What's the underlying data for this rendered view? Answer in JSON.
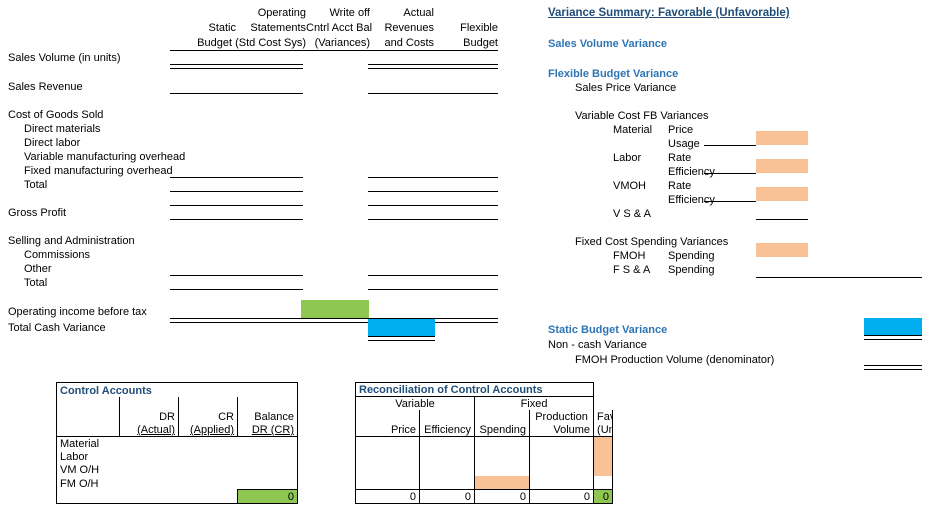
{
  "statement": {
    "column_headers": [
      {
        "lines": [
          "",
          "Static",
          "Budget (Std Cost Sys)"
        ],
        "name": "static-budget"
      },
      {
        "lines": [
          "Operating",
          "Statements",
          ""
        ],
        "name": "operating-statements"
      },
      {
        "lines": [
          "Write off",
          "Cntrl Acct Bal",
          "(Variances)"
        ],
        "name": "write-off-cntrl-acct-bal"
      },
      {
        "lines": [
          "Actual",
          "Revenues",
          "and Costs"
        ],
        "name": "actual-revenues-and-costs"
      },
      {
        "lines": [
          "",
          "Flexible",
          "Budget"
        ],
        "name": "flexible-budget"
      }
    ],
    "rows": [
      "Sales Volume (in units)",
      "Sales Revenue",
      "Cost of Goods Sold",
      "Direct materials",
      "Direct labor",
      "Variable manufacturing overhead",
      "Fixed manufacturing overhead",
      "Total",
      "Gross Profit",
      "Selling and Administration",
      "Commissions",
      "Other",
      "Total",
      "Operating income before tax",
      "Total Cash Variance"
    ]
  },
  "variance_summary": {
    "title": "Variance Summary:  Favorable (Unfavorable)",
    "sales_volume_variance": "Sales Volume Variance",
    "flexible_budget_variance": "Flexible Budget Variance",
    "sales_price_variance": "Sales Price  Variance",
    "variable_cost_heading": "Variable Cost FB Variances",
    "variable_rows": [
      {
        "category": "Material",
        "measure": "Price"
      },
      {
        "category": "",
        "measure": "Usage"
      },
      {
        "category": "Labor",
        "measure": "Rate"
      },
      {
        "category": "",
        "measure": "Efficiency"
      },
      {
        "category": "VMOH",
        "measure": "Rate"
      },
      {
        "category": "",
        "measure": "Efficiency"
      },
      {
        "category": "V S & A",
        "measure": ""
      }
    ],
    "fixed_cost_heading": "Fixed Cost Spending Variances",
    "fixed_rows": [
      {
        "category": "FMOH",
        "measure": "Spending"
      },
      {
        "category": "F S & A",
        "measure": "Spending"
      }
    ],
    "static_budget_variance": "Static Budget Variance",
    "non_cash_variance": "Non - cash Variance",
    "fmoh_production_volume": "FMOH   Production Volume (denominator)"
  },
  "control_accounts": {
    "title": "Control Accounts",
    "reconciliation_title": "Reconciliation of Control Accounts",
    "col_dr": "DR",
    "col_dr_sub": "(Actual)",
    "col_cr": "CR",
    "col_cr_sub": "(Applied)",
    "col_balance": "Balance",
    "col_balance_sub": "DR (CR)",
    "group_variable": "Variable",
    "group_fixed": "Fixed",
    "col_price": "Price",
    "col_efficiency": "Efficiency",
    "col_spending": "Spending",
    "col_production": "Production",
    "col_volume": "Volume",
    "col_fav": "Fav",
    "col_unfav": "(Unfav)",
    "rows": [
      "Material",
      "Labor",
      "VM O/H",
      "FM O/H"
    ],
    "totals": {
      "balance": "0",
      "price": "0",
      "efficiency": "0",
      "spending": "0",
      "volume": "0",
      "fav": "0"
    }
  },
  "colors": {
    "orange": "#F8C296",
    "green": "#8DC751",
    "cyan": "#00AEEF",
    "header_blue": "#2E75B6",
    "title_blue": "#1F4E79"
  }
}
